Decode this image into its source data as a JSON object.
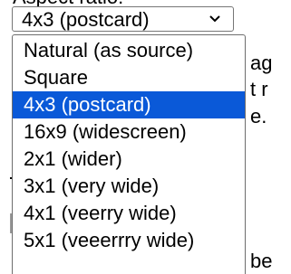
{
  "page": {
    "top_clipped_text": "Aspect ratio:",
    "bg_fragments": [
      "ag",
      "t r",
      "e.",
      "be"
    ]
  },
  "select": {
    "current_value": "4x3 (postcard)",
    "chevron_icon": "chevron-down-icon",
    "options": [
      {
        "label": "Natural (as source)",
        "selected": false
      },
      {
        "label": "Square",
        "selected": false
      },
      {
        "label": "4x3 (postcard)",
        "selected": true
      },
      {
        "label": "16x9 (widescreen)",
        "selected": false
      },
      {
        "label": "2x1 (wider)",
        "selected": false
      },
      {
        "label": "3x1 (very wide)",
        "selected": false
      },
      {
        "label": "4x1 (veerry wide)",
        "selected": false
      },
      {
        "label": "5x1 (veeerrry wide)",
        "selected": false
      }
    ]
  },
  "colors": {
    "highlight": "#0a59d8",
    "highlight_text": "#ffffff",
    "border": "#767676"
  }
}
